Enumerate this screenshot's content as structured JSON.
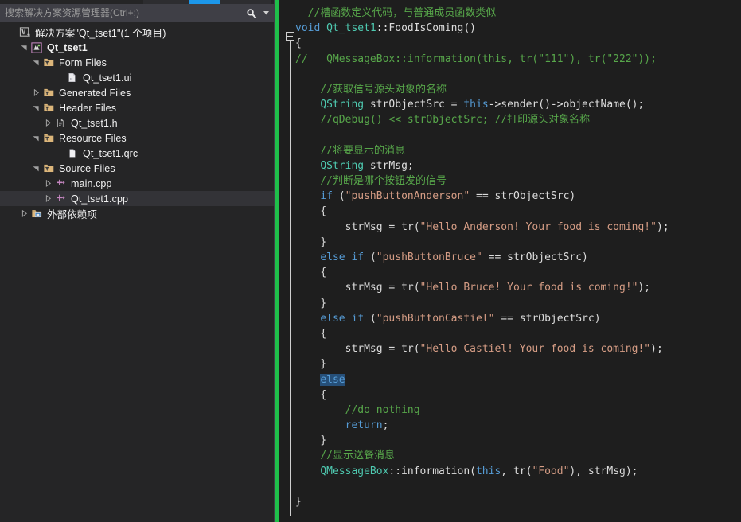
{
  "window": {
    "title": "Solution Explorer",
    "accent_blue": "#1c97ea",
    "change_bar_green": "#1fbf4a",
    "editor_bg": "#1e1e1e",
    "panel_bg": "#252526"
  },
  "search": {
    "placeholder": "搜索解决方案资源管理器(Ctrl+;)",
    "value": "",
    "icon": "search-icon",
    "dropdown_icon": "chevron-down-icon"
  },
  "tree": {
    "items": [
      {
        "label": "解决方案\"Qt_tset1\"(1 个项目)",
        "indent": 0,
        "twisty": "none",
        "icon": "solution-icon",
        "bold": false,
        "selected": false
      },
      {
        "label": "Qt_tset1",
        "indent": 1,
        "twisty": "expanded",
        "icon": "project-icon",
        "bold": true,
        "selected": false
      },
      {
        "label": "Form Files",
        "indent": 2,
        "twisty": "expanded",
        "icon": "filter-folder-icon",
        "bold": false,
        "selected": false
      },
      {
        "label": "Qt_tset1.ui",
        "indent": 4,
        "twisty": "none",
        "icon": "ui-file-icon",
        "bold": false,
        "selected": false
      },
      {
        "label": "Generated Files",
        "indent": 2,
        "twisty": "collapsed",
        "icon": "filter-folder-icon",
        "bold": false,
        "selected": false
      },
      {
        "label": "Header Files",
        "indent": 2,
        "twisty": "expanded",
        "icon": "filter-folder-icon",
        "bold": false,
        "selected": false
      },
      {
        "label": "Qt_tset1.h",
        "indent": 3,
        "twisty": "collapsed",
        "icon": "header-file-icon",
        "bold": false,
        "selected": false
      },
      {
        "label": "Resource Files",
        "indent": 2,
        "twisty": "expanded",
        "icon": "filter-folder-icon",
        "bold": false,
        "selected": false
      },
      {
        "label": "Qt_tset1.qrc",
        "indent": 4,
        "twisty": "none",
        "icon": "generic-file-icon",
        "bold": false,
        "selected": false
      },
      {
        "label": "Source Files",
        "indent": 2,
        "twisty": "expanded",
        "icon": "filter-folder-icon",
        "bold": false,
        "selected": false
      },
      {
        "label": "main.cpp",
        "indent": 3,
        "twisty": "collapsed",
        "icon": "cpp-file-icon",
        "bold": false,
        "selected": false
      },
      {
        "label": "Qt_tset1.cpp",
        "indent": 3,
        "twisty": "collapsed",
        "icon": "cpp-file-icon",
        "bold": false,
        "selected": true
      },
      {
        "label": "外部依赖项",
        "indent": 1,
        "twisty": "collapsed",
        "icon": "dependencies-icon",
        "bold": false,
        "selected": false
      }
    ]
  },
  "editor": {
    "language": "cpp",
    "fold_marker": "collapse-minus-box",
    "lines": [
      {
        "tokens": [
          {
            "t": "  //槽函数定义代码，与普通成员函数类似",
            "c": "comment"
          }
        ]
      },
      {
        "tokens": [
          {
            "t": "void",
            "c": "keyword"
          },
          {
            "t": " ",
            "c": "plain"
          },
          {
            "t": "Qt_tset1",
            "c": "type"
          },
          {
            "t": "::FoodIsComing()",
            "c": "plain"
          }
        ],
        "indent": 0
      },
      {
        "tokens": [
          {
            "t": "{",
            "c": "plain"
          }
        ],
        "indent": 0
      },
      {
        "tokens": [
          {
            "t": "//   QMessageBox::information(this, tr(\"111\"), tr(\"222\"));",
            "c": "comment"
          }
        ],
        "indent": 0
      },
      {
        "tokens": []
      },
      {
        "tokens": [
          {
            "t": "//获取信号源头对象的名称",
            "c": "comment"
          }
        ],
        "indent": 4
      },
      {
        "tokens": [
          {
            "t": "QString",
            "c": "type"
          },
          {
            "t": " strObjectSrc = ",
            "c": "plain"
          },
          {
            "t": "this",
            "c": "keyword"
          },
          {
            "t": "->sender()->objectName();",
            "c": "plain"
          }
        ],
        "indent": 4
      },
      {
        "tokens": [
          {
            "t": "//qDebug() << strObjectSrc; //打印源头对象名称",
            "c": "comment"
          }
        ],
        "indent": 4
      },
      {
        "tokens": []
      },
      {
        "tokens": [
          {
            "t": "//将要显示的消息",
            "c": "comment"
          }
        ],
        "indent": 4
      },
      {
        "tokens": [
          {
            "t": "QString",
            "c": "type"
          },
          {
            "t": " strMsg;",
            "c": "plain"
          }
        ],
        "indent": 4
      },
      {
        "tokens": [
          {
            "t": "//判断是哪个按钮发的信号",
            "c": "comment"
          }
        ],
        "indent": 4
      },
      {
        "tokens": [
          {
            "t": "if",
            "c": "keyword"
          },
          {
            "t": " (",
            "c": "plain"
          },
          {
            "t": "\"pushButtonAnderson\"",
            "c": "string"
          },
          {
            "t": " == strObjectSrc)",
            "c": "plain"
          }
        ],
        "indent": 4
      },
      {
        "tokens": [
          {
            "t": "{",
            "c": "plain"
          }
        ],
        "indent": 4
      },
      {
        "tokens": [
          {
            "t": "strMsg = tr(",
            "c": "plain"
          },
          {
            "t": "\"Hello Anderson! Your food is coming!\"",
            "c": "string"
          },
          {
            "t": ");",
            "c": "plain"
          }
        ],
        "indent": 8
      },
      {
        "tokens": [
          {
            "t": "}",
            "c": "plain"
          }
        ],
        "indent": 4
      },
      {
        "tokens": [
          {
            "t": "else if",
            "c": "keyword"
          },
          {
            "t": " (",
            "c": "plain"
          },
          {
            "t": "\"pushButtonBruce\"",
            "c": "string"
          },
          {
            "t": " == strObjectSrc)",
            "c": "plain"
          }
        ],
        "indent": 4
      },
      {
        "tokens": [
          {
            "t": "{",
            "c": "plain"
          }
        ],
        "indent": 4
      },
      {
        "tokens": [
          {
            "t": "strMsg = tr(",
            "c": "plain"
          },
          {
            "t": "\"Hello Bruce! Your food is coming!\"",
            "c": "string"
          },
          {
            "t": ");",
            "c": "plain"
          }
        ],
        "indent": 8
      },
      {
        "tokens": [
          {
            "t": "}",
            "c": "plain"
          }
        ],
        "indent": 4
      },
      {
        "tokens": [
          {
            "t": "else if",
            "c": "keyword"
          },
          {
            "t": " (",
            "c": "plain"
          },
          {
            "t": "\"pushButtonCastiel\"",
            "c": "string"
          },
          {
            "t": " == strObjectSrc)",
            "c": "plain"
          }
        ],
        "indent": 4
      },
      {
        "tokens": [
          {
            "t": "{",
            "c": "plain"
          }
        ],
        "indent": 4
      },
      {
        "tokens": [
          {
            "t": "strMsg = tr(",
            "c": "plain"
          },
          {
            "t": "\"Hello Castiel! Your food is coming!\"",
            "c": "string"
          },
          {
            "t": ");",
            "c": "plain"
          }
        ],
        "indent": 8
      },
      {
        "tokens": [
          {
            "t": "}",
            "c": "plain"
          }
        ],
        "indent": 4
      },
      {
        "tokens": [
          {
            "t": "else",
            "c": "keyword-selected"
          }
        ],
        "indent": 4
      },
      {
        "tokens": [
          {
            "t": "{",
            "c": "plain"
          }
        ],
        "indent": 4
      },
      {
        "tokens": [
          {
            "t": "//do nothing",
            "c": "comment"
          }
        ],
        "indent": 8
      },
      {
        "tokens": [
          {
            "t": "return",
            "c": "keyword"
          },
          {
            "t": ";",
            "c": "plain"
          }
        ],
        "indent": 8
      },
      {
        "tokens": [
          {
            "t": "}",
            "c": "plain"
          }
        ],
        "indent": 4
      },
      {
        "tokens": [
          {
            "t": "//显示送餐消息",
            "c": "comment"
          }
        ],
        "indent": 4
      },
      {
        "tokens": [
          {
            "t": "QMessageBox",
            "c": "type"
          },
          {
            "t": "::information(",
            "c": "plain"
          },
          {
            "t": "this",
            "c": "keyword"
          },
          {
            "t": ", tr(",
            "c": "plain"
          },
          {
            "t": "\"Food\"",
            "c": "string"
          },
          {
            "t": "), strMsg);",
            "c": "plain"
          }
        ],
        "indent": 4
      },
      {
        "tokens": []
      },
      {
        "tokens": [
          {
            "t": "}",
            "c": "plain"
          }
        ],
        "indent": 0
      }
    ]
  },
  "colors": {
    "comment": "#57a64a",
    "keyword": "#569cd6",
    "type": "#4ec9b0",
    "string": "#d69d85",
    "plain": "#dcdcdc",
    "selection": "#264f78"
  }
}
